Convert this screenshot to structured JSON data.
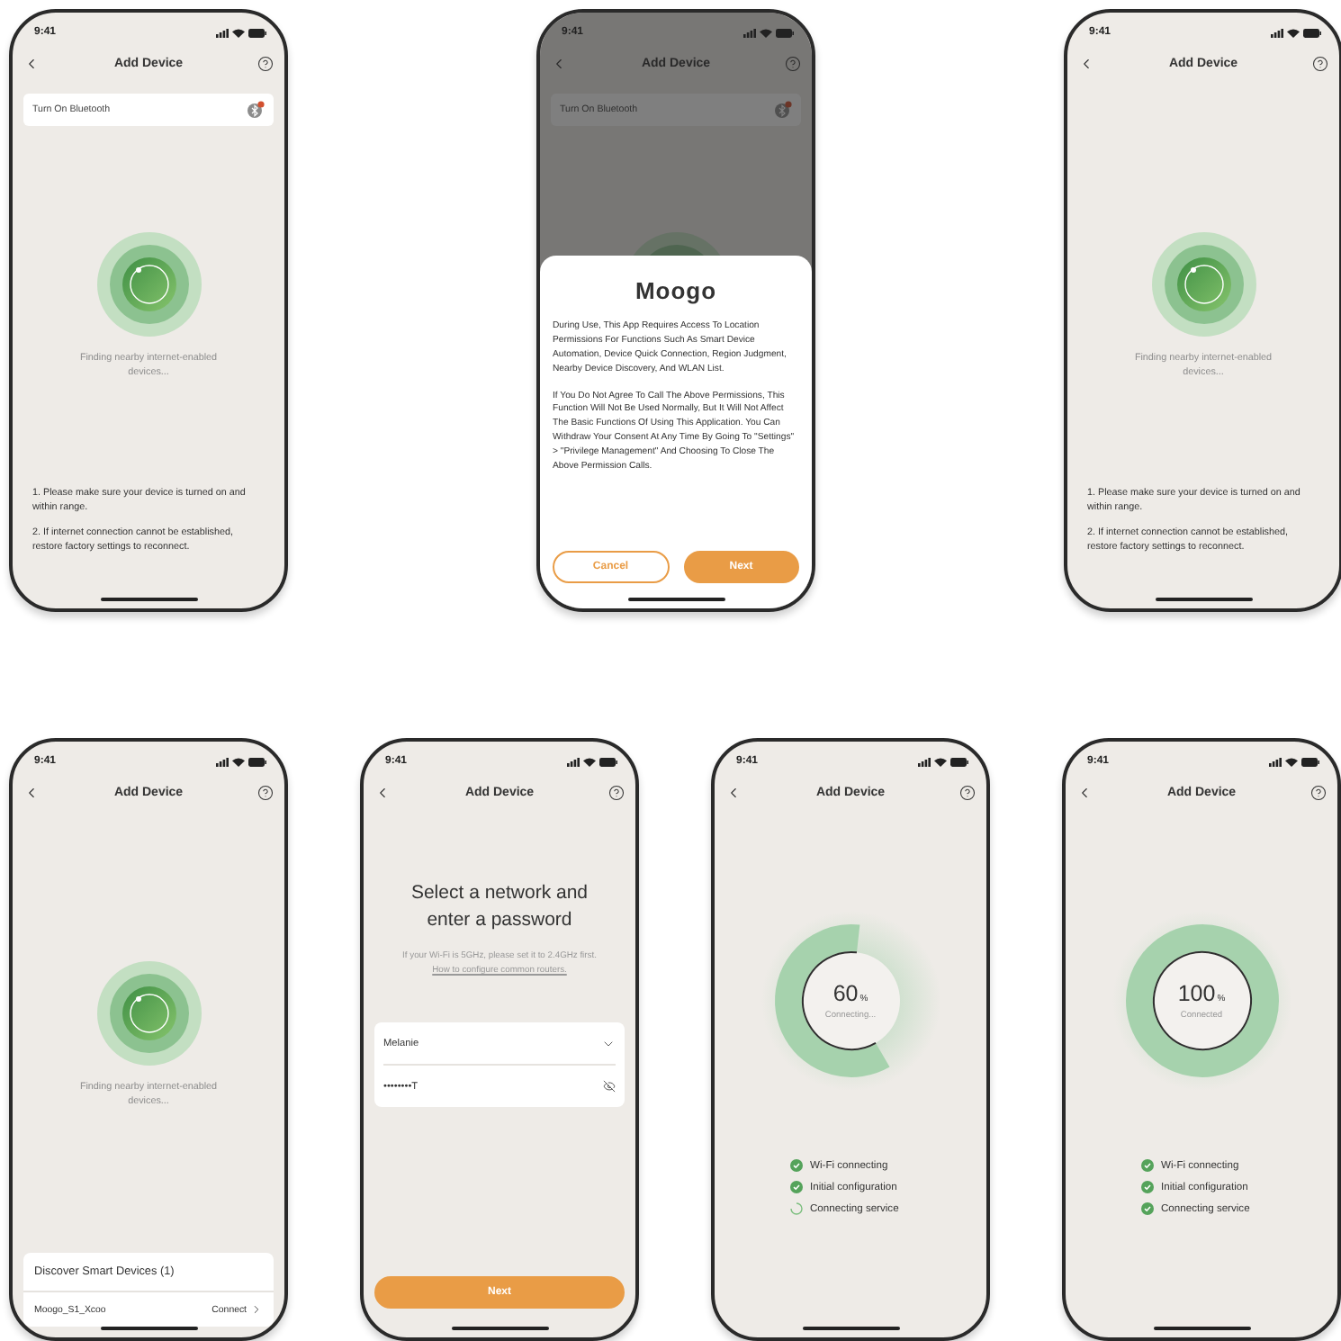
{
  "phones": [
    {
      "kind": "scan",
      "time": "9:41",
      "title": "Add Device",
      "banner": "Turn On Bluetooth",
      "finding": "Finding nearby internet-enabled devices...",
      "tips": [
        "1. Please make sure your device is turned on and within range.",
        "2. If internet connection cannot be established, restore factory settings to reconnect."
      ]
    },
    {
      "kind": "permission",
      "time": "9:41",
      "title": "Add Device",
      "banner": "Turn On Bluetooth",
      "dialog": {
        "logo": "Moogo",
        "paragraphs": [
          "During Use, This App Requires Access To Location Permissions For Functions Such As Smart Device Automation, Device Quick Connection, Region Judgment, Nearby Device Discovery, And WLAN List.",
          "If You Do Not Agree To Call The Above Permissions, This Function Will Not Be Used Normally, But It Will Not Affect The Basic Functions Of Using This Application. You Can Withdraw Your Consent At Any Time By Going To \"Settings\" > \"Privilege Management\" And Choosing To Close The Above Permission Calls."
        ],
        "buttons": [
          {
            "label": "Cancel",
            "primary": false
          },
          {
            "label": "Next",
            "primary": true
          }
        ]
      }
    },
    {
      "kind": "scan",
      "time": "9:41",
      "title": "Add Device",
      "finding": "Finding nearby internet-enabled devices...",
      "tips": [
        "1. Please make sure your device is turned on and within range.",
        "2. If internet connection cannot be established, restore factory settings to reconnect."
      ]
    },
    {
      "kind": "scan",
      "time": "9:41",
      "title": "Add Device",
      "finding": "Finding nearby internet-enabled devices...",
      "discover": {
        "title": "Discover Smart Devices (1)",
        "devices": [
          {
            "name": "Moogo_S1_Xcoo",
            "action": "Connect"
          }
        ]
      }
    },
    {
      "kind": "network",
      "time": "9:41",
      "title": "Add Device",
      "heading": "Select a network and enter a password",
      "hint": "If your Wi-Fi is 5GHz, please set it to 2.4GHz first.",
      "link": "How to configure common routers.",
      "network": "Melanie",
      "password": "••••••••T",
      "button": "Next"
    },
    {
      "kind": "progress",
      "time": "9:41",
      "title": "Add Device",
      "percent": "60",
      "unit": "%",
      "status": "Connecting...",
      "level": 0.6,
      "steps": [
        {
          "label": "Wi-Fi connecting",
          "done": true
        },
        {
          "label": "Initial configuration",
          "done": true
        },
        {
          "label": "Connecting service",
          "done": false
        }
      ]
    },
    {
      "kind": "progress",
      "time": "9:41",
      "title": "Add Device",
      "percent": "100",
      "unit": "%",
      "status": "Connected",
      "level": 1,
      "steps": [
        {
          "label": "Wi-Fi connecting",
          "done": true
        },
        {
          "label": "Initial configuration",
          "done": true
        },
        {
          "label": "Connecting service",
          "done": true
        }
      ]
    }
  ]
}
